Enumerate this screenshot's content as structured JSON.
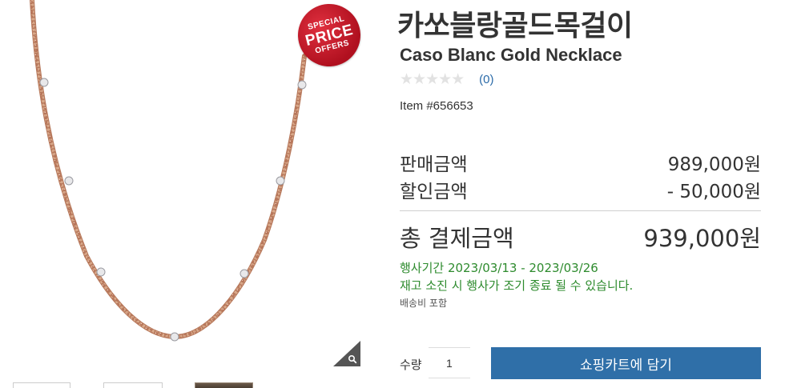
{
  "product": {
    "title_ko": "카쏘블랑골드목걸이",
    "title_en": "Caso Blanc Gold Necklace",
    "rating_stars": "★★★★★",
    "rating_value": 0,
    "review_count": "(0)",
    "item_number": "Item #656653"
  },
  "badge": {
    "line1": "SPECIAL",
    "line2": "PRICE",
    "line3": "OFFERS"
  },
  "icons": {
    "zoom": "magnifier-icon",
    "rating": "star-icon"
  },
  "pricing": {
    "sale_price_label": "판매금액",
    "sale_price_value": "989,000원",
    "discount_label": "할인금액",
    "discount_value": "- 50,000원",
    "total_label": "총 결제금액",
    "total_value": "939,000원"
  },
  "promotion": {
    "period": "행사기간 2023/03/13 - 2023/03/26",
    "note": "재고 소진 시 행사가 조기 종료 될 수 있습니다.",
    "shipping": "배송비 포함"
  },
  "cart": {
    "quantity_label": "수량",
    "quantity_value": "1",
    "add_button_label": "쇼핑카트에 담기"
  },
  "colors": {
    "accent": "#2f6fa8",
    "promo_text": "#2e8b2e",
    "badge_red": "#c8192b",
    "review_link": "#2a6aa8"
  }
}
